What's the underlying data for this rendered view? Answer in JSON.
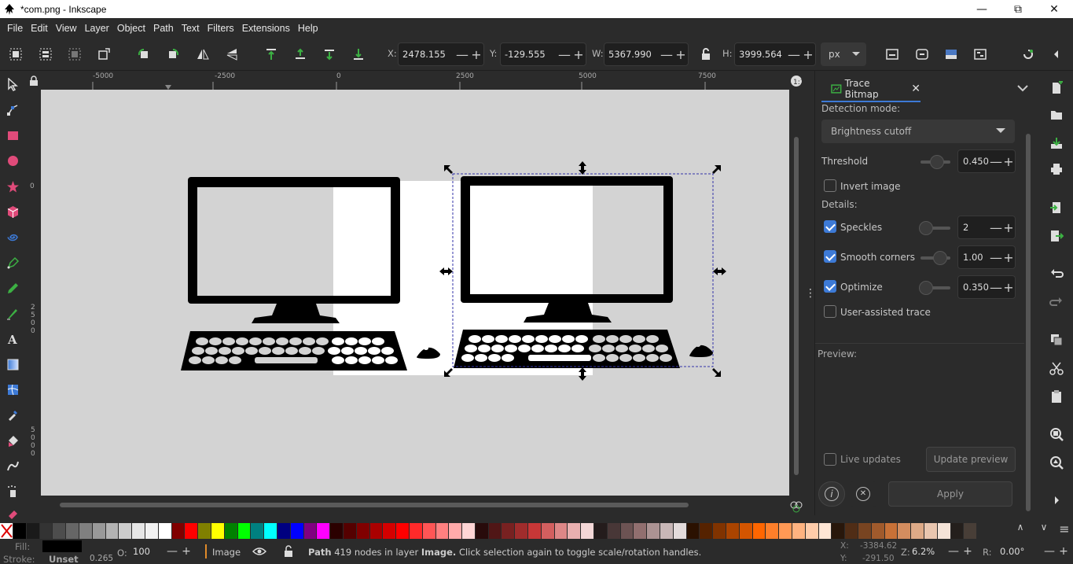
{
  "window": {
    "title": "*com.png - Inkscape",
    "minimize": "—",
    "maximize": "⧉",
    "close": "✕"
  },
  "menu": [
    "File",
    "Edit",
    "View",
    "Layer",
    "Object",
    "Path",
    "Text",
    "Filters",
    "Extensions",
    "Help"
  ],
  "toolbar": {
    "x_label": "X:",
    "x_value": "2478.155",
    "y_label": "Y:",
    "y_value": "-129.555",
    "w_label": "W:",
    "w_value": "5367.990",
    "h_label": "H:",
    "h_value": "3999.564",
    "unit": "px",
    "minus": "—",
    "plus": "+"
  },
  "rulers": {
    "h_ticks": [
      "-5000",
      "-2500",
      "0",
      "2500",
      "5000",
      "7500"
    ],
    "v_ticks": [
      "0",
      "2500",
      "5000"
    ]
  },
  "trace_panel": {
    "tab_label": "Trace Bitmap",
    "tab_close": "✕",
    "detection_label": "Detection mode:",
    "detection_value": "Brightness cutoff",
    "threshold_label": "Threshold",
    "threshold_value": "0.450",
    "threshold_level": 0.45,
    "invert_label": "Invert image",
    "invert_checked": false,
    "details_label": "Details:",
    "speckles_label": "Speckles",
    "speckles_value": "2",
    "speckles_checked": true,
    "smooth_label": "Smooth corners",
    "smooth_value": "1.00",
    "smooth_checked": true,
    "optimize_label": "Optimize",
    "optimize_value": "0.350",
    "optimize_checked": true,
    "user_assisted_label": "User-assisted trace",
    "user_assisted_checked": false,
    "preview_label": "Preview:",
    "live_updates_label": "Live updates",
    "live_updates_checked": false,
    "update_preview_label": "Update preview",
    "apply_label": "Apply",
    "info_glyph": "i",
    "reset_glyph": "✕",
    "minus": "—",
    "plus": "+",
    "grip": "⋮"
  },
  "palette": {
    "colors": [
      "#000000",
      "#1a1a1a",
      "#333333",
      "#4d4d4d",
      "#666666",
      "#808080",
      "#999999",
      "#b3b3b3",
      "#cccccc",
      "#e6e6e6",
      "#f2f2f2",
      "#ffffff",
      "#800000",
      "#ff0000",
      "#808000",
      "#ffff00",
      "#008000",
      "#00ff00",
      "#008080",
      "#00ffff",
      "#000080",
      "#0000ff",
      "#800080",
      "#ff00ff",
      "#2b0000",
      "#550000",
      "#800000",
      "#aa0000",
      "#d40000",
      "#ff0000",
      "#ff2a2a",
      "#ff5555",
      "#ff8080",
      "#ffaaaa",
      "#ffd5d5",
      "#280b0b",
      "#501616",
      "#782121",
      "#a02c2c",
      "#c83737",
      "#d35f5f",
      "#de8787",
      "#e9afaf",
      "#f4d7d7",
      "#241c1c",
      "#483737",
      "#6c5353",
      "#916f6f",
      "#ac9393",
      "#c8b7b7",
      "#e3dbdb",
      "#2b1100",
      "#552200",
      "#803300",
      "#aa4400",
      "#d45500",
      "#ff6600",
      "#ff7f2a",
      "#ff9955",
      "#ffb380",
      "#ffccaa",
      "#ffe6d5",
      "#28170b",
      "#502d16",
      "#784421",
      "#a05a2c",
      "#c87137",
      "#d38d5f",
      "#deaa87",
      "#e9c6af",
      "#f4e3d7",
      "#241f1c",
      "#483e37"
    ],
    "up": "∧",
    "down": "∨",
    "menu": "≡"
  },
  "status": {
    "fill_label": "Fill:",
    "stroke_label": "Stroke:",
    "stroke_value": "Unset",
    "stroke_width": "0.265",
    "opacity_label": "O:",
    "opacity_value": "100",
    "layer_name": "Image",
    "message_prefix": "Path",
    "message_mid": "419 nodes in layer",
    "message_layer": "Image.",
    "message_suffix": "Click selection again to toggle scale/rotation handles.",
    "cursor_x_label": "X:",
    "cursor_x": "-3384.62",
    "cursor_y_label": "Y:",
    "cursor_y": "-291.50",
    "zoom_label": "Z:",
    "zoom": "6.2%",
    "rotation_label": "R:",
    "rotation": "0.00°",
    "minus": "—",
    "plus": "+"
  },
  "icons": {
    "selector": "selector-arrow-icon",
    "node": "node-tool-icon",
    "rect": "rectangle-icon",
    "circle": "ellipse-icon",
    "star": "star-icon",
    "box3d": "box-3d-icon",
    "spiral": "spiral-icon",
    "pen": "pen-icon",
    "pencil": "pencil-icon",
    "calligraphy": "calligraphy-icon",
    "text": "text-tool-icon",
    "gradient": "gradient-icon",
    "mesh": "mesh-icon",
    "dropper": "dropper-icon",
    "bucket": "paint-bucket-icon",
    "tweak": "tweak-icon",
    "spray": "spray-icon",
    "eraser": "eraser-icon"
  },
  "colors": {
    "accent": "#3d7ad6",
    "canvas": "#d3d3d3",
    "ui_bg": "#2b2b2b"
  }
}
